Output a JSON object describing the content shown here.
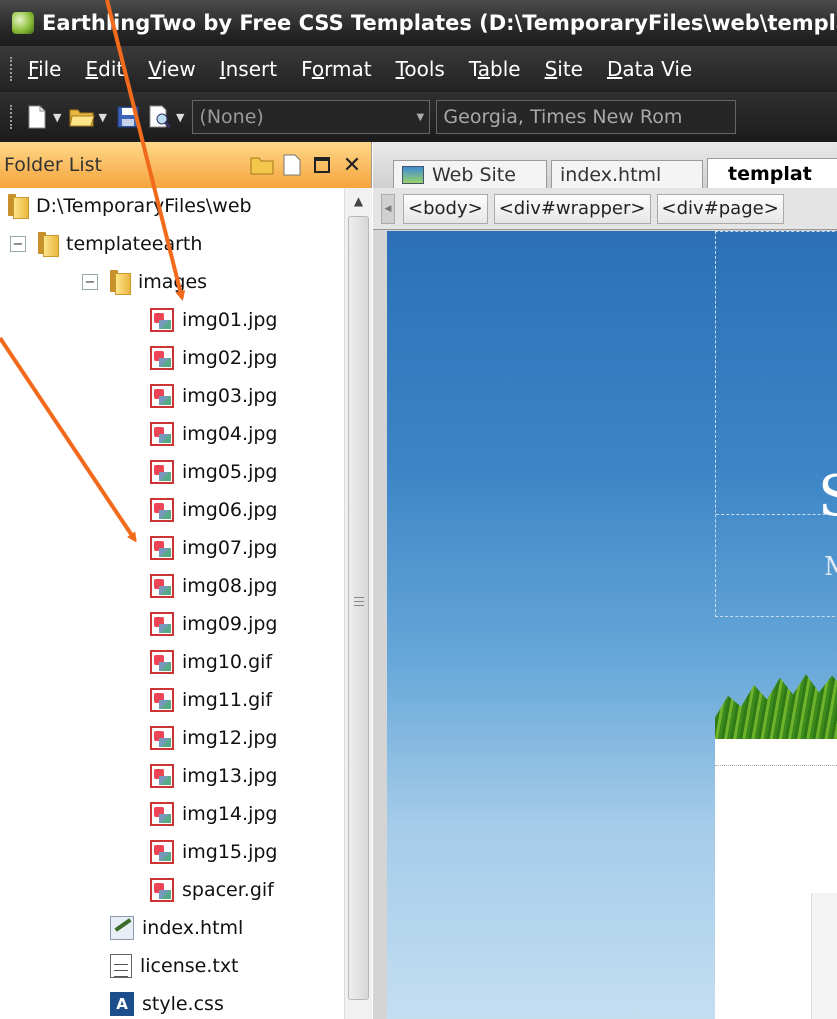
{
  "window": {
    "title": "EarthlingTwo by Free CSS Templates (D:\\TemporaryFiles\\web\\template"
  },
  "menubar": {
    "items": [
      {
        "pre": "",
        "ul": "F",
        "post": "ile"
      },
      {
        "pre": "",
        "ul": "E",
        "post": "dit"
      },
      {
        "pre": "",
        "ul": "V",
        "post": "iew"
      },
      {
        "pre": "",
        "ul": "I",
        "post": "nsert"
      },
      {
        "pre": "F",
        "ul": "o",
        "post": "rmat"
      },
      {
        "pre": "",
        "ul": "T",
        "post": "ools"
      },
      {
        "pre": "T",
        "ul": "a",
        "post": "ble"
      },
      {
        "pre": "",
        "ul": "S",
        "post": "ite"
      },
      {
        "pre": "",
        "ul": "D",
        "post": "ata Vie"
      }
    ]
  },
  "toolbar": {
    "style_combo": "(None)",
    "font_combo": "Georgia, Times New Rom"
  },
  "folder_list": {
    "title": "Folder List",
    "root": "D:\\TemporaryFiles\\web",
    "folder_templateearth": "templateearth",
    "folder_images": "images",
    "image_files": [
      "img01.jpg",
      "img02.jpg",
      "img03.jpg",
      "img04.jpg",
      "img05.jpg",
      "img06.jpg",
      "img07.jpg",
      "img08.jpg",
      "img09.jpg",
      "img10.gif",
      "img11.gif",
      "img12.jpg",
      "img13.jpg",
      "img14.jpg",
      "img15.jpg",
      "spacer.gif"
    ],
    "index_file": "index.html",
    "license_file": "license.txt",
    "style_file": "style.css"
  },
  "editor": {
    "tabs": [
      "Web Site",
      "index.html",
      "templat"
    ],
    "breadcrumbs": [
      "<body>",
      "<div#wrapper>",
      "<div#page>"
    ]
  },
  "canvas": {
    "logo_letter": "S",
    "logo_sub": "M"
  },
  "colors": {
    "annotation_arrow": "#f26a1b",
    "folder_header": "#f5a43c",
    "sky_top": "#2b70b6",
    "sky_bottom": "#c4def1"
  }
}
